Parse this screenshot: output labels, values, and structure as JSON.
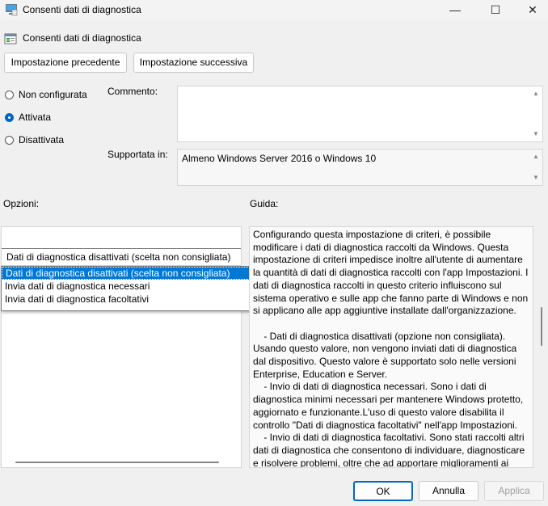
{
  "window": {
    "title": "Consenti dati di diagnostica",
    "minimize": "—",
    "maximize": "☐",
    "close": "✕"
  },
  "header": {
    "title": "Consenti dati di diagnostica"
  },
  "nav": {
    "previous": "Impostazione precedente",
    "next": "Impostazione successiva"
  },
  "state": {
    "not_configured": "Non configurata",
    "enabled": "Attivata",
    "disabled": "Disattivata",
    "selected": "enabled"
  },
  "comment": {
    "label": "Commento:",
    "value": ""
  },
  "supported": {
    "label": "Supportata in:",
    "value": "Almeno Windows Server 2016 o Windows 10"
  },
  "options": {
    "label": "Opzioni:",
    "selected_value": "Dati di diagnostica disattivati (scelta non consigliata)",
    "list": [
      "Dati di diagnostica disattivati (scelta non consigliata)",
      "Invia dati di diagnostica necessari",
      "Invia dati di diagnostica facoltativi"
    ]
  },
  "guide": {
    "label": "Guida:",
    "text": "Configurando questa impostazione di criteri, è possibile modificare i dati di diagnostica raccolti da Windows. Questa impostazione di criteri impedisce inoltre all'utente di aumentare la quantità di dati di diagnostica raccolti con l'app Impostazioni. I dati di diagnostica raccolti in questo criterio influiscono sul sistema operativo e sulle app che fanno parte di Windows e non si applicano alle app aggiuntive installate dall'organizzazione.\n\n    - Dati di diagnostica disattivati (opzione non consigliata). Usando questo valore, non vengono inviati dati di diagnostica dal dispositivo. Questo valore è supportato solo nelle versioni Enterprise, Education e Server.\n    - Invio di dati di diagnostica necessari. Sono i dati di diagnostica minimi necessari per mantenere Windows protetto, aggiornato e funzionante.L'uso di questo valore disabilita il controllo \"Dati di diagnostica facoltativi\" nell'app Impostazioni.\n    - Invio di dati di diagnostica facoltativi. Sono stati raccolti altri dati di diagnostica che consentono di individuare, diagnosticare e risolvere problemi, oltre che ad apportare miglioramenti ai prodotti. I dati di diagnostica richiesti verranno sempre inclusi se"
  },
  "footer": {
    "ok": "OK",
    "cancel": "Annulla",
    "apply": "Applica"
  },
  "colors": {
    "accent": "#0067c0",
    "selection": "#0078d4",
    "disabled_text": "#a0a0a0"
  }
}
